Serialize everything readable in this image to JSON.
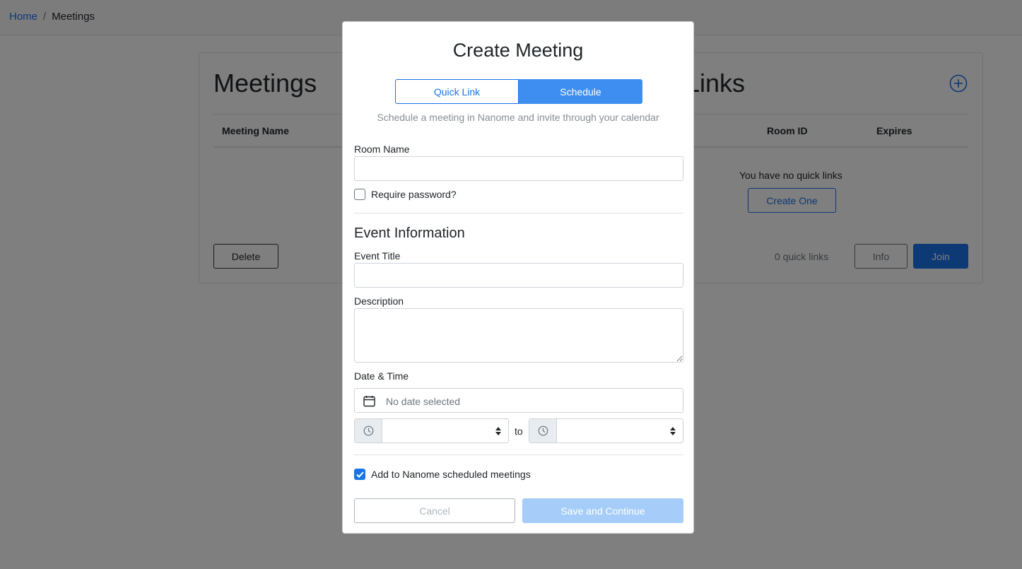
{
  "breadcrumb": {
    "home": "Home",
    "separator": "/",
    "current": "Meetings"
  },
  "page": {
    "meetings_title": "Meetings",
    "links_title_visible": "Links",
    "columns": {
      "meeting_name": "Meeting Name",
      "room_id": "Room ID",
      "expires": "Expires"
    },
    "empty_quick_links": "You have no quick links",
    "create_one": "Create One",
    "delete": "Delete",
    "quick_links_count": "0 quick links",
    "info": "Info",
    "join": "Join",
    "accent": "#1a73e8"
  },
  "modal": {
    "title": "Create Meeting",
    "tabs": {
      "quick_link": "Quick Link",
      "schedule": "Schedule"
    },
    "selected_tab": "Schedule",
    "subtitle": "Schedule a meeting in Nanome and invite through your calendar",
    "room_name_label": "Room Name",
    "room_name_value": "",
    "require_password_label": "Require password?",
    "require_password_checked": false,
    "event_section_title": "Event Information",
    "event_title_label": "Event Title",
    "event_title_value": "",
    "description_label": "Description",
    "description_value": "",
    "datetime_label": "Date & Time",
    "date_placeholder": "No date selected",
    "start_time_value": "",
    "to_label": "to",
    "end_time_value": "",
    "add_scheduled_label": "Add to Nanome scheduled meetings",
    "add_scheduled_checked": true,
    "cancel": "Cancel",
    "save": "Save and Continue"
  }
}
